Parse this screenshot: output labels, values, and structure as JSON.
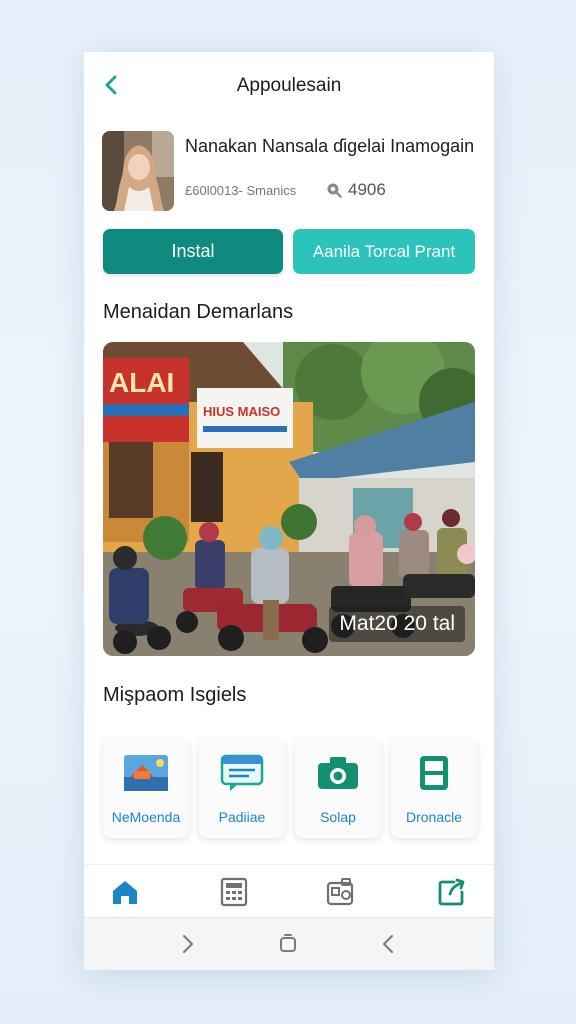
{
  "header": {
    "title": "Appoulesain"
  },
  "profile": {
    "name": "Nanakan Nansala ɗigelai Inamogain",
    "meta": "£60l0013- Smanics",
    "rating": "4906"
  },
  "actions": {
    "install_label": "Instal",
    "secondary_label": "Aanila Torcal Prant"
  },
  "gallery": {
    "section_title": "Menaidan Demarlans",
    "caption": "Mat20 20 tal",
    "banner_left": "ALAI",
    "banner_right": "HIUS MAISO"
  },
  "features": {
    "section_title": "Mişpaom Isgiels",
    "items": [
      {
        "label": "NeMoenda",
        "icon": "scene-picture-icon"
      },
      {
        "label": "Padiiae",
        "icon": "chat-list-icon"
      },
      {
        "label": "Solap",
        "icon": "camera-icon"
      },
      {
        "label": "Dronacle",
        "icon": "split-square-icon"
      }
    ]
  },
  "tabbar": {
    "items": [
      "home-icon",
      "calculator-icon",
      "gallery-icon",
      "edit-share-icon"
    ],
    "active": "home-icon"
  },
  "colors": {
    "primary": "#0f8a7e",
    "accent": "#2dc3bd",
    "link_blue": "#1a86c8",
    "icon_green": "#12906f"
  }
}
